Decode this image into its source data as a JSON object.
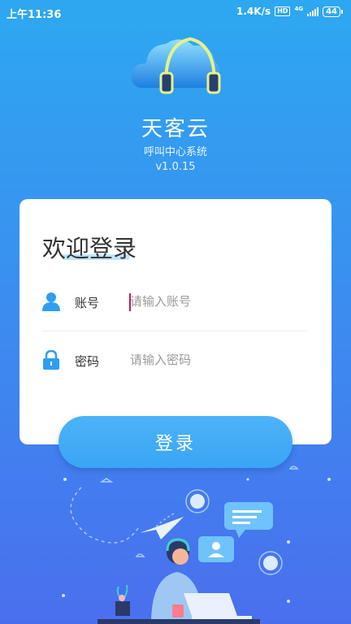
{
  "status_bar": {
    "time": "上午11:36",
    "net_speed": "1.4K/s",
    "hd_badge": "HD",
    "network_type": "4G",
    "battery": "44"
  },
  "app": {
    "name": "天客云",
    "subtitle": "呼叫中心系统",
    "version": "v1.0.15"
  },
  "login": {
    "title": "欢迎登录",
    "account_label": "账号",
    "account_placeholder": "请输入账号",
    "password_label": "密码",
    "password_placeholder": "请输入密码",
    "button_label": "登录"
  },
  "icons": {
    "logo": "cloud-headset-logo",
    "account": "user-icon",
    "password": "lock-icon",
    "illustration": "call-center-agent-illustration"
  },
  "colors": {
    "primary": "#3aa5f5",
    "background_top": "#2da8f0",
    "background_bottom": "#4a6fee",
    "caret": "#c2185b"
  }
}
